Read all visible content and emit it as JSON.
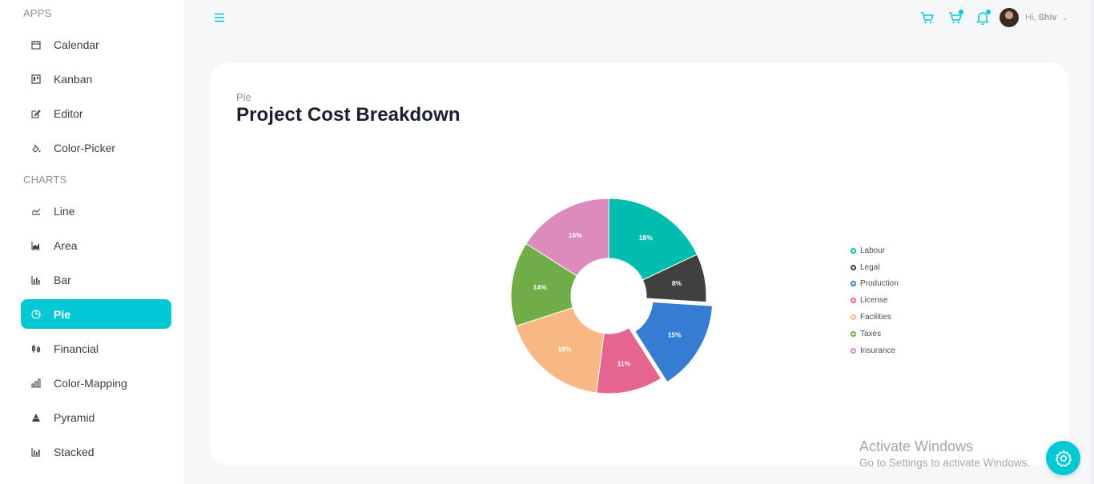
{
  "sidebar": {
    "apps_title": "APPS",
    "charts_title": "CHARTS",
    "apps": [
      {
        "label": "Calendar",
        "icon": "calendar-icon"
      },
      {
        "label": "Kanban",
        "icon": "kanban-icon"
      },
      {
        "label": "Editor",
        "icon": "editor-icon"
      },
      {
        "label": "Color-Picker",
        "icon": "color-picker-icon"
      }
    ],
    "charts": [
      {
        "label": "Line",
        "icon": "line-chart-icon"
      },
      {
        "label": "Area",
        "icon": "area-chart-icon"
      },
      {
        "label": "Bar",
        "icon": "bar-chart-icon"
      },
      {
        "label": "Pie",
        "icon": "pie-chart-icon",
        "active": true
      },
      {
        "label": "Financial",
        "icon": "financial-chart-icon"
      },
      {
        "label": "Color-Mapping",
        "icon": "color-mapping-icon"
      },
      {
        "label": "Pyramid",
        "icon": "pyramid-icon"
      },
      {
        "label": "Stacked",
        "icon": "stacked-chart-icon"
      }
    ]
  },
  "header": {
    "greeting": "Hi,",
    "user_name": "Shiv",
    "icons": [
      "menu-icon",
      "cart-icon",
      "chat-icon",
      "notification-icon"
    ]
  },
  "card": {
    "subtitle": "Pie",
    "title": "Project Cost Breakdown"
  },
  "watermark": {
    "line1": "Activate Windows",
    "line2": "Go to Settings to activate Windows."
  },
  "theme": {
    "accent": "#03c9d7"
  },
  "chart_data": {
    "type": "pie",
    "donut": true,
    "exploded_slice": "Production",
    "legend_position": "right",
    "categories": [
      "Labour",
      "Legal",
      "Production",
      "License",
      "Facilities",
      "Taxes",
      "Insurance"
    ],
    "values": [
      18,
      8,
      15,
      11,
      18,
      14,
      16
    ],
    "data_labels": [
      "18%",
      "8%",
      "15%",
      "11%",
      "18%",
      "14%",
      "16%"
    ],
    "colors": [
      "#00bdae",
      "#404041",
      "#357cd2",
      "#e56590",
      "#f8b883",
      "#70ad47",
      "#dd8abd"
    ]
  }
}
